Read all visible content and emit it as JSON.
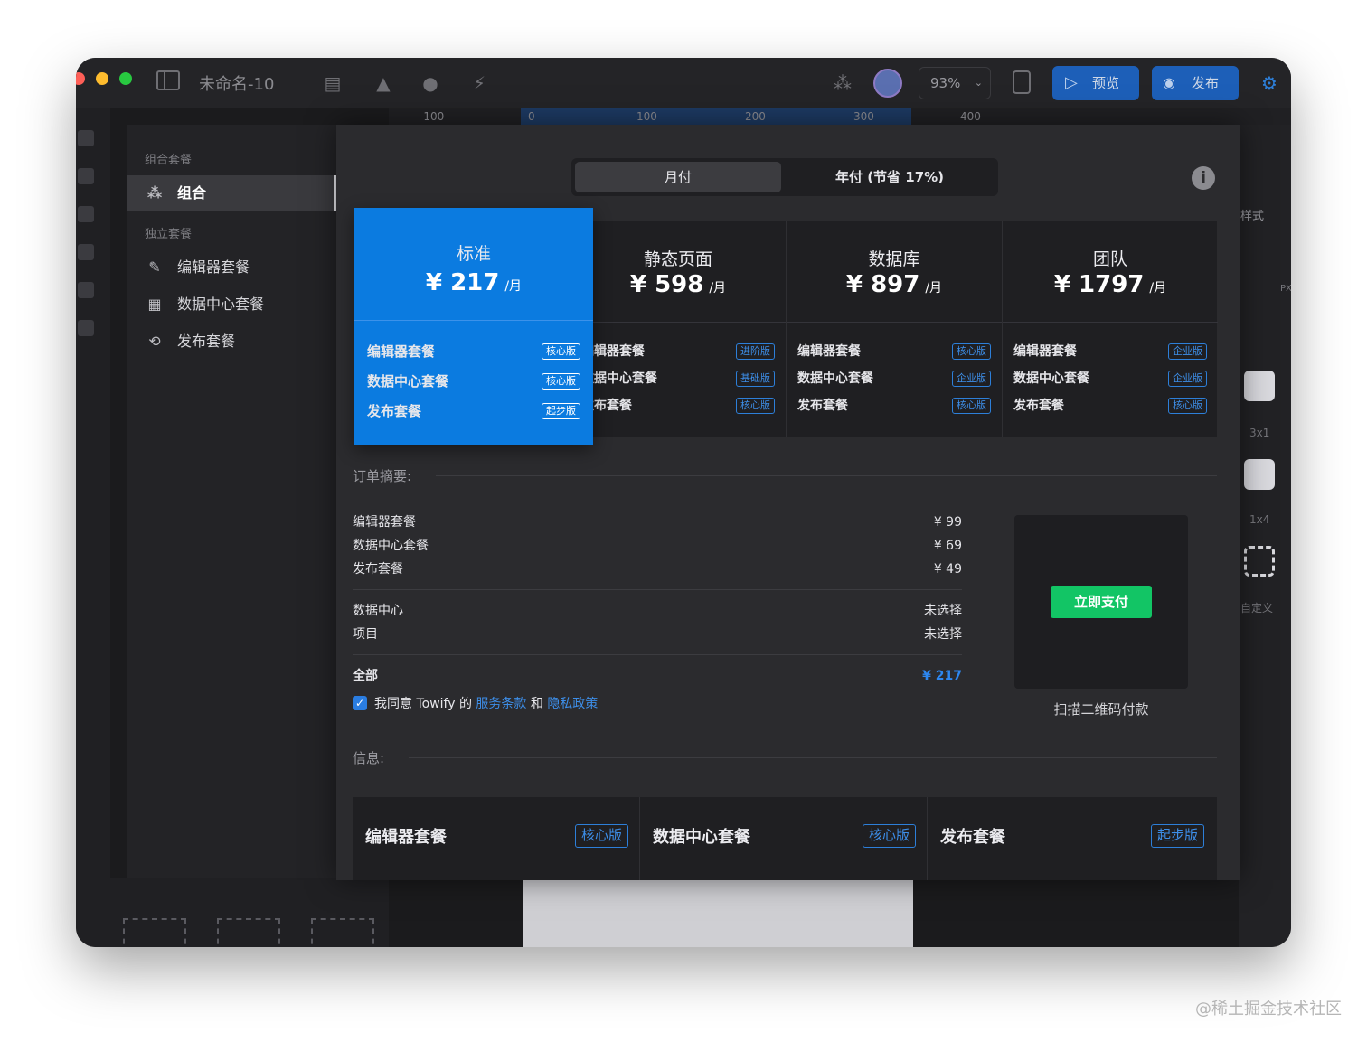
{
  "titlebar": {
    "doc_title": "未命名-10",
    "zoom": "93%",
    "preview_label": "预览",
    "publish_label": "发布",
    "accent_color": "#2a6fc9"
  },
  "ruler": {
    "ticks": [
      "-100",
      "0",
      "100",
      "200",
      "300",
      "400"
    ]
  },
  "left_panel": {
    "section_combo": "组合套餐",
    "section_single": "独立套餐",
    "items": [
      {
        "label": "组合",
        "icon": "group-icon",
        "active": true
      },
      {
        "label": "编辑器套餐",
        "icon": "brush-icon"
      },
      {
        "label": "数据中心套餐",
        "icon": "table-icon"
      },
      {
        "label": "发布套餐",
        "icon": "publish-icon"
      }
    ]
  },
  "inspector": {
    "style_label": "样式",
    "layout_labels": [
      "3x1",
      "1x4",
      "自定义"
    ],
    "unit": "PX"
  },
  "modal": {
    "billing": {
      "monthly": "月付",
      "yearly": "年付 (节省 17%)"
    },
    "plans": [
      {
        "name": "标准",
        "price": "¥ 217",
        "per": "/月",
        "rows": [
          {
            "label": "编辑器套餐",
            "tag": "核心版"
          },
          {
            "label": "数据中心套餐",
            "tag": "核心版"
          },
          {
            "label": "发布套餐",
            "tag": "起步版"
          }
        ]
      },
      {
        "name": "静态页面",
        "price": "¥ 598",
        "per": "/月",
        "rows": [
          {
            "label": "编辑器套餐",
            "tag": "进阶版"
          },
          {
            "label": "数据中心套餐",
            "tag": "基础版"
          },
          {
            "label": "发布套餐",
            "tag": "核心版"
          }
        ]
      },
      {
        "name": "数据库",
        "price": "¥ 897",
        "per": "/月",
        "rows": [
          {
            "label": "编辑器套餐",
            "tag": "核心版"
          },
          {
            "label": "数据中心套餐",
            "tag": "企业版"
          },
          {
            "label": "发布套餐",
            "tag": "核心版"
          }
        ]
      },
      {
        "name": "团队",
        "price": "¥ 1797",
        "per": "/月",
        "rows": [
          {
            "label": "编辑器套餐",
            "tag": "企业版"
          },
          {
            "label": "数据中心套餐",
            "tag": "企业版"
          },
          {
            "label": "发布套餐",
            "tag": "核心版"
          }
        ]
      }
    ],
    "summary": {
      "title": "订单摘要:",
      "lines": [
        {
          "label": "编辑器套餐",
          "value": "¥ 99"
        },
        {
          "label": "数据中心套餐",
          "value": "¥ 69"
        },
        {
          "label": "发布套餐",
          "value": "¥ 49"
        }
      ],
      "options": [
        {
          "label": "数据中心",
          "value": "未选择"
        },
        {
          "label": "项目",
          "value": "未选择"
        }
      ],
      "total_label": "全部",
      "total_value": "¥ 217",
      "agree_prefix": "我同意 Towify 的",
      "terms": "服务条款",
      "and": "和",
      "privacy": "隐私政策"
    },
    "pay": {
      "button": "立即支付",
      "qr_caption": "扫描二维码付款"
    },
    "info": {
      "title": "信息:",
      "cards": [
        {
          "name": "编辑器套餐",
          "tag": "核心版"
        },
        {
          "name": "数据中心套餐",
          "tag": "核心版"
        },
        {
          "name": "发布套餐",
          "tag": "起步版"
        }
      ]
    }
  },
  "watermark": "@稀土掘金技术社区"
}
